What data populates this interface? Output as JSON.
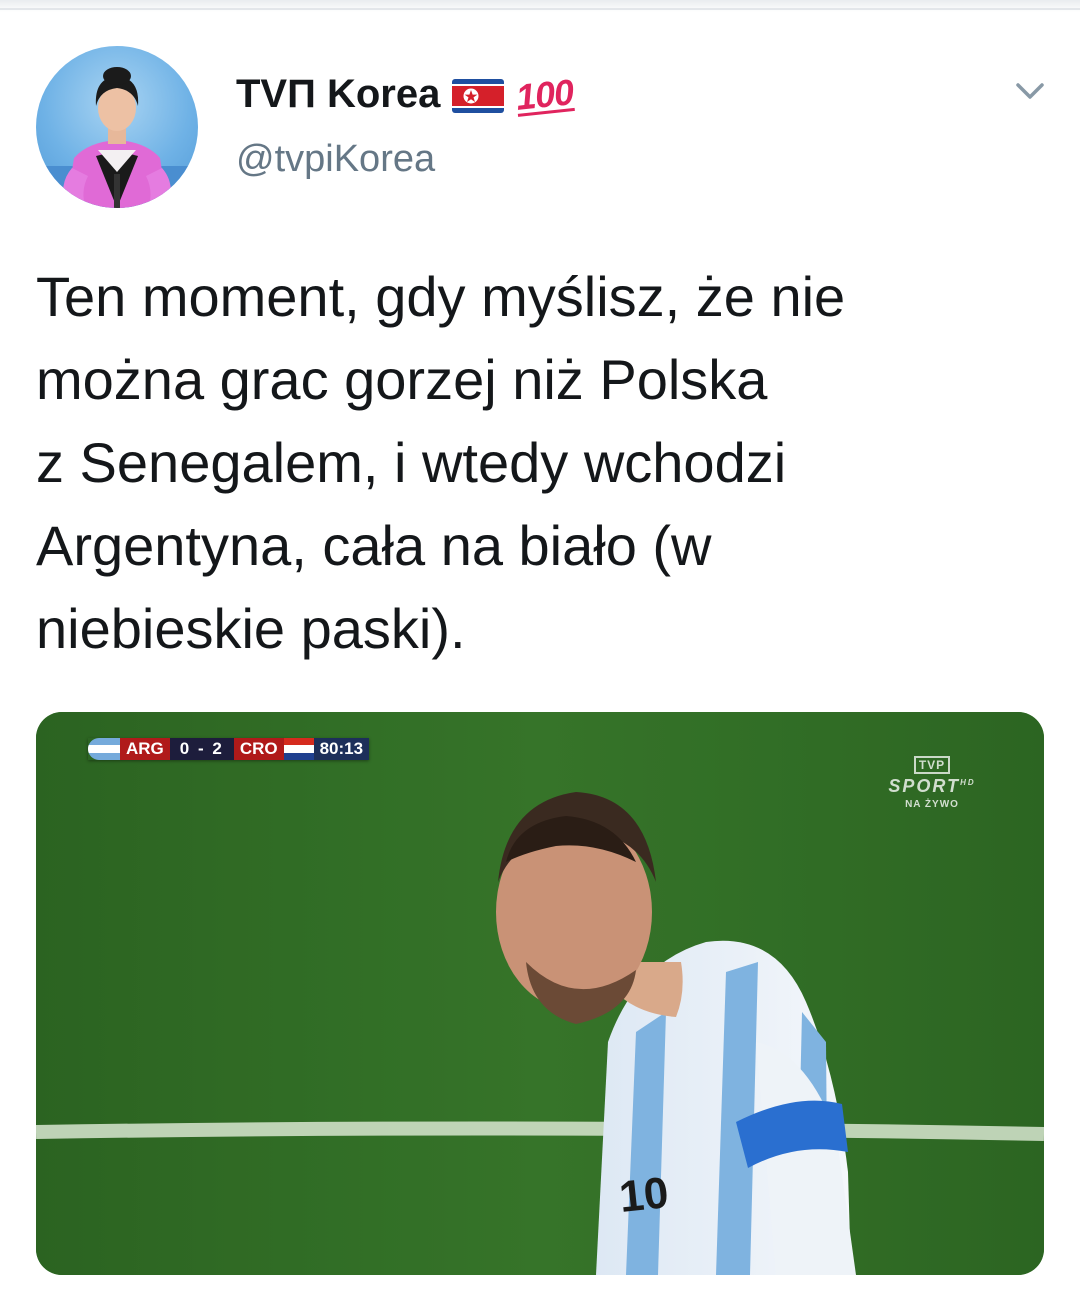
{
  "tweet": {
    "display_name": "ТVП Korea",
    "handle": "@tvpiKorea",
    "text": "Ten moment, gdy myślisz, że nie\nmożna grac gorzej niż Polska\nz Senegalem, i wtedy wchodzi\nArgentyna, cała na biało (w\nniebieskie paski).",
    "badges": [
      "flag-north-korea-icon",
      "hundred-points-icon"
    ],
    "hundred_label": "100"
  },
  "media": {
    "scoreboard": {
      "home": "ARG",
      "score": "0 - 2",
      "away": "CRO",
      "clock": "80:13"
    },
    "broadcaster": {
      "logo_top": "TVP",
      "logo_main": "SPORT",
      "logo_hd": "HD",
      "logo_bottom": "NA ŻYWO"
    }
  },
  "colors": {
    "text": "#14171a",
    "secondary": "#657786",
    "accent": "#e0245e",
    "pitch": "#2f6e25"
  }
}
